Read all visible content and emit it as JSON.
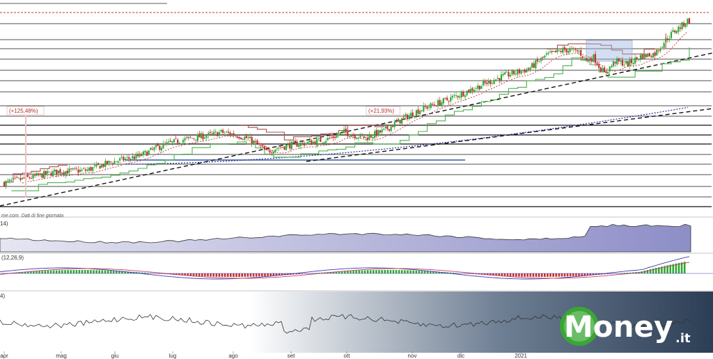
{
  "chart_data": {
    "type": "candlestick",
    "months": [
      "apr",
      "mag",
      "giu",
      "lug",
      "ago",
      "set",
      "ott",
      "nov",
      "dic",
      "2021"
    ],
    "source_note": "me.com. Dati di fine giornata",
    "annotations": [
      "(+125,48%)",
      "(+21,93%)"
    ],
    "indicators": {
      "volume_label": "14)",
      "macd_label": "(12,26,9)",
      "rsi_label": "4)"
    },
    "price_path": [
      [
        0,
        0.0
      ],
      [
        15,
        0.6
      ],
      [
        30,
        1.2
      ],
      [
        45,
        1.3
      ],
      [
        60,
        2.2
      ],
      [
        75,
        2.8
      ],
      [
        85,
        3.7
      ],
      [
        95,
        4.3
      ],
      [
        105,
        4.7
      ],
      [
        115,
        5.0
      ],
      [
        120,
        5.25
      ],
      [
        128,
        5.0
      ],
      [
        135,
        4.6
      ],
      [
        140,
        4.0
      ],
      [
        145,
        3.2
      ],
      [
        150,
        3.6
      ],
      [
        160,
        4.0
      ],
      [
        170,
        4.2
      ],
      [
        180,
        4.6
      ],
      [
        188,
        5.25
      ],
      [
        195,
        4.9
      ],
      [
        200,
        4.7
      ],
      [
        210,
        5.4
      ],
      [
        220,
        6.6
      ],
      [
        230,
        7.6
      ],
      [
        245,
        8.6
      ],
      [
        260,
        9.8
      ],
      [
        275,
        11.0
      ],
      [
        290,
        11.8
      ],
      [
        300,
        13.2
      ],
      [
        310,
        13.8
      ],
      [
        318,
        13.6
      ],
      [
        322,
        12.7
      ],
      [
        326,
        13.0
      ],
      [
        332,
        11.3
      ],
      [
        338,
        12.6
      ],
      [
        345,
        12.3
      ],
      [
        352,
        13.1
      ],
      [
        360,
        13.4
      ],
      [
        365,
        14.6
      ],
      [
        370,
        15.6
      ],
      [
        375,
        16.3
      ],
      [
        378,
        16.8
      ]
    ]
  },
  "logo": {
    "word": "Money",
    "suffix": ".it",
    "accent": "#3aa635"
  },
  "colors": {
    "up": "#2fa833",
    "down": "#c23030",
    "resistance": "#b44a4a",
    "support": "#4ab04a",
    "ma_short": "#d04040",
    "ma_long": "#2a2aa0",
    "level_line": "#2c5aa0"
  }
}
